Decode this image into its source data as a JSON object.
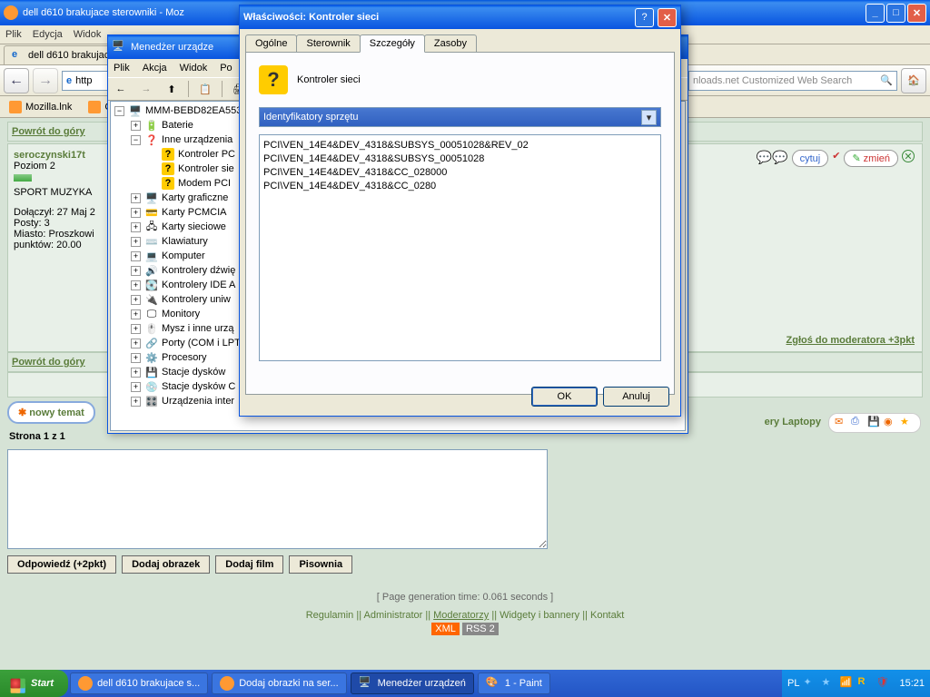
{
  "firefox": {
    "title": "dell d610 brakujace sterowniki - Moz",
    "menu": [
      "Plik",
      "Edycja",
      "Widok"
    ],
    "tab_label": "dell d610 brakujace",
    "url": "http",
    "search_placeholder": "nloads.net Customized Web Search",
    "bookmarks": [
      "Mozilla.lnk",
      "Cze"
    ]
  },
  "forum": {
    "back_top": "Powrót do góry",
    "user": {
      "name": "seroczynski17t",
      "level": "Poziom 2",
      "sig": "SPORT MUZYKA",
      "joined": "Dołączył: 27 Maj 2",
      "posts": "Posty: 3",
      "city": "Miasto: Proszkowi",
      "points": "punktów: 20.00"
    },
    "actions": {
      "quote": "cytuj",
      "edit": "zmień"
    },
    "mod_link": "Zgłoś do moderatora +3pkt",
    "new_topic": "nowy temat",
    "page": "Strona 1 z 1",
    "breadcrumb_right": "ery Laptopy",
    "reply_buttons": [
      "Odpowiedź (+2pkt)",
      "Dodaj obrazek",
      "Dodaj film",
      "Pisownia"
    ],
    "gen_time": "[ Page generation time: 0.061 seconds ]",
    "footer": [
      "Regulamin",
      "Administrator",
      "Moderatorzy",
      "Widgety i bannery",
      "Kontakt"
    ],
    "xml": "XML",
    "rss": "RSS 2"
  },
  "devmgr": {
    "title": "Menedżer urządze",
    "menu": [
      "Plik",
      "Akcja",
      "Widok",
      "Po"
    ],
    "root": "MMM-BEBD82EA553",
    "nodes": [
      {
        "label": "Baterie",
        "icon": "battery"
      },
      {
        "label": "Inne urządzenia",
        "icon": "other",
        "expanded": true,
        "children": [
          {
            "label": "Kontroler PC",
            "warn": true
          },
          {
            "label": "Kontroler sie",
            "warn": true
          },
          {
            "label": "Modem PCI",
            "warn": true
          }
        ]
      },
      {
        "label": "Karty graficzne",
        "icon": "display"
      },
      {
        "label": "Karty PCMCIA",
        "icon": "pcmcia"
      },
      {
        "label": "Karty sieciowe",
        "icon": "network"
      },
      {
        "label": "Klawiatury",
        "icon": "keyboard"
      },
      {
        "label": "Komputer",
        "icon": "computer"
      },
      {
        "label": "Kontrolery dźwię",
        "icon": "sound"
      },
      {
        "label": "Kontrolery IDE A",
        "icon": "ide"
      },
      {
        "label": "Kontrolery uniw",
        "icon": "usb"
      },
      {
        "label": "Monitory",
        "icon": "monitor"
      },
      {
        "label": "Mysz i inne urzą",
        "icon": "mouse"
      },
      {
        "label": "Porty (COM i LPT",
        "icon": "port"
      },
      {
        "label": "Procesory",
        "icon": "cpu"
      },
      {
        "label": "Stacje dysków",
        "icon": "disk"
      },
      {
        "label": "Stacje dysków C",
        "icon": "cdrom"
      },
      {
        "label": "Urządzenia inter",
        "icon": "hid"
      }
    ]
  },
  "props": {
    "title": "Właściwości: Kontroler sieci",
    "tabs": [
      "Ogólne",
      "Sterownik",
      "Szczegóły",
      "Zasoby"
    ],
    "active_tab": 2,
    "device_name": "Kontroler sieci",
    "dropdown": "Identyfikatory sprzętu",
    "hwids": [
      "PCI\\VEN_14E4&DEV_4318&SUBSYS_00051028&REV_02",
      "PCI\\VEN_14E4&DEV_4318&SUBSYS_00051028",
      "PCI\\VEN_14E4&DEV_4318&CC_028000",
      "PCI\\VEN_14E4&DEV_4318&CC_0280"
    ],
    "ok": "OK",
    "cancel": "Anuluj"
  },
  "taskbar": {
    "start": "Start",
    "items": [
      "dell d610 brakujace s...",
      "Dodaj obrazki na ser...",
      "Menedżer urządzeń",
      "1 - Paint"
    ],
    "lang": "PL",
    "clock": "15:21"
  }
}
